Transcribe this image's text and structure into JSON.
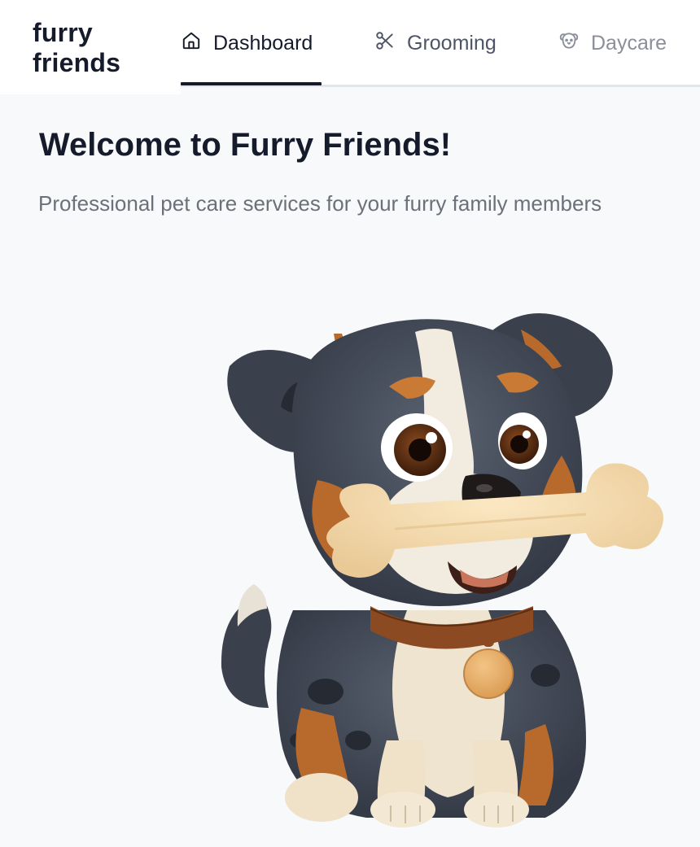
{
  "brand": {
    "line1": "furry",
    "line2": "friends"
  },
  "nav": {
    "tabs": [
      {
        "label": "Dashboard",
        "icon": "home-icon",
        "active": true
      },
      {
        "label": "Grooming",
        "icon": "scissors-icon",
        "active": false
      },
      {
        "label": "Daycare",
        "icon": "dog-face-icon",
        "active": false
      }
    ]
  },
  "hero": {
    "headline_pre": "Welcome to ",
    "headline_brand": "Furry Friends",
    "headline_post": "!",
    "subtitle": "Professional pet care services for your furry family members",
    "illustration": "puppy-with-bone-illustration"
  },
  "colors": {
    "text": "#161b2c",
    "muted": "#6b7079",
    "background": "#f8f9fb",
    "active_tab_underline": "#161b2c"
  }
}
